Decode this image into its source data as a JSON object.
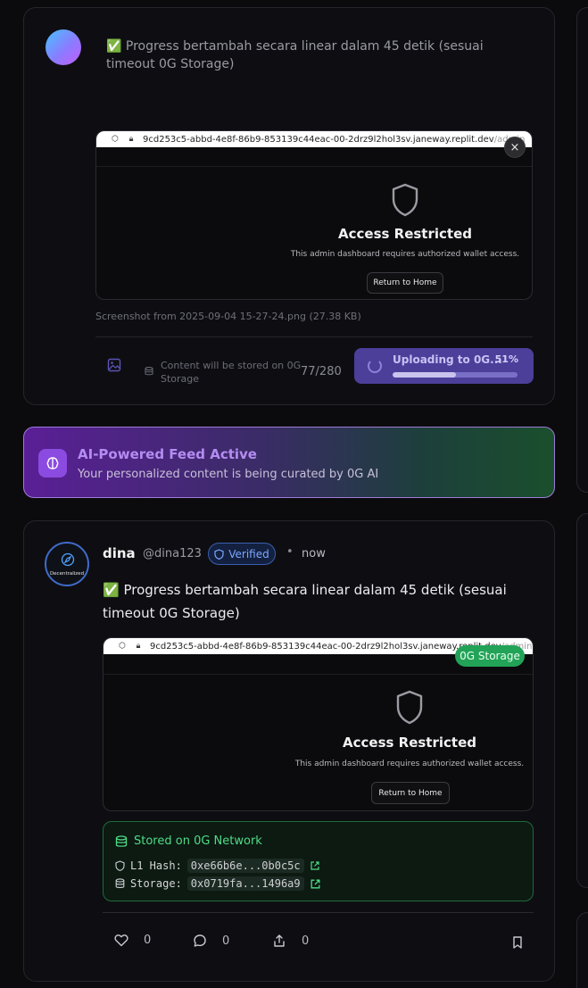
{
  "composer": {
    "text": "✅ Progress bertambah secara linear dalam 45 detik (sesuai timeout 0G Storage)",
    "attachment": {
      "url_host": "9cd253c5-abbd-4e8f-86b9-853139c44eac-00-2drz9l2hol3sv.janeway.replit.dev",
      "url_path": "/admin",
      "title": "Access Restricted",
      "description": "This admin dashboard requires authorized wallet access.",
      "button": "Return to Home",
      "close": "×"
    },
    "file_caption": "Screenshot from 2025-09-04 15-27-24.png (27.38 KB)",
    "storage_note": "Content will be stored on 0G Storage",
    "char_count": "77/280",
    "upload": {
      "label": "Uploading to 0G...",
      "percent_label": "51%",
      "progress": 0.51
    }
  },
  "ai_banner": {
    "title": "AI-Powered Feed Active",
    "subtitle": "Your personalized content is being curated by 0G AI"
  },
  "post": {
    "avatar_label": "Decentralized",
    "name": "dina",
    "handle": "@dina123",
    "verified": "Verified",
    "separator": "•",
    "time": "now",
    "text": "✅ Progress bertambah secara linear dalam 45 detik (sesuai timeout 0G Storage)",
    "attachment": {
      "url_host": "9cd253c5-abbd-4e8f-86b9-853139c44eac-00-2drz9l2hol3sv.janeway.replit.dev",
      "url_path": "/admin",
      "title": "Access Restricted",
      "description": "This admin dashboard requires authorized wallet access.",
      "button": "Return to Home",
      "badge": "0G Storage"
    },
    "storage": {
      "heading": "Stored on 0G Network",
      "l1_label": "L1 Hash:",
      "l1_value": "0xe66b6e...0b0c5c",
      "storage_label": "Storage:",
      "storage_value": "0x0719fa...1496a9"
    },
    "actions": {
      "likes": "0",
      "comments": "0",
      "shares": "0"
    }
  },
  "colors": {
    "accent_purple": "#4b3f9a",
    "green": "#22a357",
    "verified_blue": "#7ea7ff"
  }
}
